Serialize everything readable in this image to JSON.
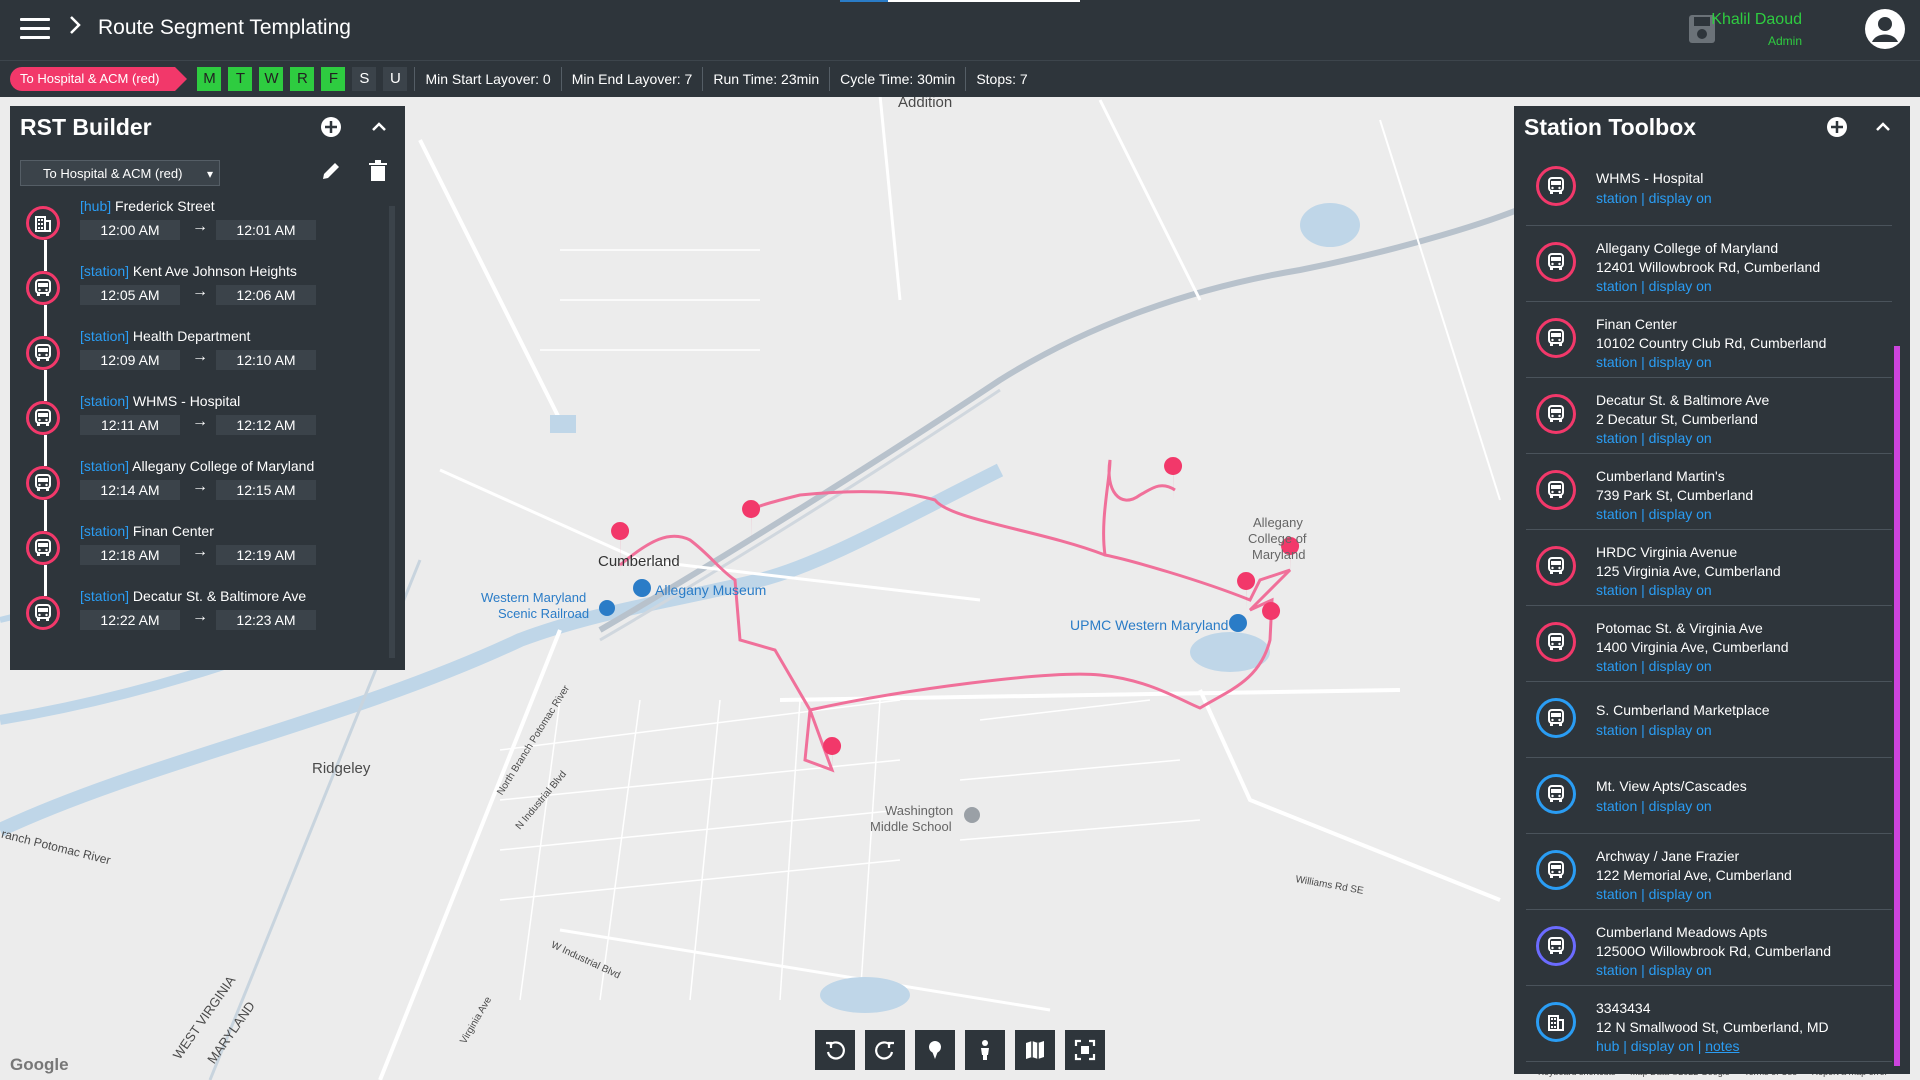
{
  "header": {
    "title": "Route Segment Templating",
    "user_name": "Khalil Daoud",
    "user_role": "Admin"
  },
  "infobar": {
    "route": "To Hospital & ACM (red)",
    "days": [
      {
        "label": "M",
        "active": true
      },
      {
        "label": "T",
        "active": true
      },
      {
        "label": "W",
        "active": true
      },
      {
        "label": "R",
        "active": true
      },
      {
        "label": "F",
        "active": true
      },
      {
        "label": "S",
        "active": false
      },
      {
        "label": "U",
        "active": false
      }
    ],
    "min_start_layover": "Min Start Layover:  0",
    "min_end_layover": "Min End Layover:  7",
    "run_time": "Run Time:  23min",
    "cycle_time": "Cycle Time:  30min",
    "stops": "Stops:  7"
  },
  "rst": {
    "title": "RST Builder",
    "selected_route": "To Hospital & ACM (red)",
    "stops": [
      {
        "type": "[hub]",
        "name": "Frederick Street",
        "arrive": "12:00 AM",
        "depart": "12:01 AM",
        "icon": "building-icon"
      },
      {
        "type": "[station]",
        "name": "Kent Ave Johnson Heights",
        "arrive": "12:05 AM",
        "depart": "12:06 AM",
        "icon": "bus-icon"
      },
      {
        "type": "[station]",
        "name": "Health Department",
        "arrive": "12:09 AM",
        "depart": "12:10 AM",
        "icon": "bus-icon"
      },
      {
        "type": "[station]",
        "name": "WHMS - Hospital",
        "arrive": "12:11 AM",
        "depart": "12:12 AM",
        "icon": "bus-icon"
      },
      {
        "type": "[station]",
        "name": "Allegany College of Maryland",
        "arrive": "12:14 AM",
        "depart": "12:15 AM",
        "icon": "bus-icon"
      },
      {
        "type": "[station]",
        "name": "Finan Center",
        "arrive": "12:18 AM",
        "depart": "12:19 AM",
        "icon": "bus-icon"
      },
      {
        "type": "[station]",
        "name": "Decatur St. & Baltimore Ave",
        "arrive": "12:22 AM",
        "depart": "12:23 AM",
        "icon": "bus-icon"
      }
    ]
  },
  "toolbox": {
    "title": "Station Toolbox",
    "items": [
      {
        "name": "WHMS - Hospital",
        "address": "",
        "links": "station | display on",
        "notes": "",
        "color": "#f2386a",
        "icon": "bus-icon"
      },
      {
        "name": "Allegany College of Maryland",
        "address": "12401 Willowbrook Rd, Cumberland",
        "links": "station | display on",
        "notes": "",
        "color": "#f2386a",
        "icon": "bus-icon"
      },
      {
        "name": "Finan Center",
        "address": "10102 Country Club Rd, Cumberland",
        "links": "station | display on",
        "notes": "",
        "color": "#f2386a",
        "icon": "bus-icon"
      },
      {
        "name": "Decatur St. & Baltimore Ave",
        "address": "2 Decatur St, Cumberland",
        "links": "station | display on",
        "notes": "",
        "color": "#f2386a",
        "icon": "bus-icon"
      },
      {
        "name": "Cumberland Martin's",
        "address": "739 Park St, Cumberland",
        "links": "station | display on",
        "notes": "",
        "color": "#f2386a",
        "icon": "bus-icon"
      },
      {
        "name": "HRDC Virginia Avenue",
        "address": "125 Virginia Ave, Cumberland",
        "links": "station | display on",
        "notes": "",
        "color": "#f2386a",
        "icon": "bus-icon"
      },
      {
        "name": "Potomac St. & Virginia Ave",
        "address": "1400 Virginia Ave, Cumberland",
        "links": "station | display on",
        "notes": "",
        "color": "#f2386a",
        "icon": "bus-icon"
      },
      {
        "name": "S. Cumberland Marketplace",
        "address": "",
        "links": "station | display on",
        "notes": "",
        "color": "#2a9df4",
        "icon": "bus-icon"
      },
      {
        "name": "Mt. View Apts/Cascades",
        "address": "",
        "links": "station | display on",
        "notes": "",
        "color": "#2a9df4",
        "icon": "bus-icon"
      },
      {
        "name": "Archway / Jane Frazier",
        "address": "122 Memorial Ave, Cumberland",
        "links": "station | display on",
        "notes": "",
        "color": "#2a9df4",
        "icon": "bus-icon"
      },
      {
        "name": "Cumberland Meadows Apts",
        "address": "12500O Willowbrook Rd, Cumberland",
        "links": "station | display on",
        "notes": "",
        "color": "#6b6bff",
        "icon": "bus-icon"
      },
      {
        "name": "3343434",
        "address": "12 N Smallwood St, Cumberland, MD",
        "links": "hub | display on | ",
        "notes": "notes",
        "color": "#2a9df4",
        "icon": "building-icon"
      }
    ]
  },
  "map": {
    "labels": {
      "addition": "Addition",
      "cumberland": "Cumberland",
      "western_md_1": "Western Maryland",
      "western_md_2": "Scenic Railroad",
      "allegany_museum": "Allegany Museum",
      "allegany_college_1": "Allegany",
      "allegany_college_2": "College of",
      "allegany_college_3": "Maryland",
      "upmc": "UPMC Western Maryland",
      "ridgeley": "Ridgeley",
      "washington_ms_1": "Washington",
      "washington_ms_2": "Middle School",
      "williams_rd": "Williams Rd SE",
      "north_branch": "North Branch Potomac River",
      "branch_potomac": "ranch Potomac River",
      "west_virginia": "WEST VIRGINIA",
      "maryland": "MARYLAND",
      "w_industrial": "W Industrial Blvd",
      "virginia_ave": "Virginia Ave",
      "n_industrial": "N Industrial Blvd"
    },
    "google": "Google",
    "footer": [
      "Keyboard shortcuts",
      "Map Data ©2022 Google",
      "Terms of Use",
      "Report a map error"
    ]
  },
  "map_tools": [
    "rotate-left-icon",
    "rotate-right-icon",
    "marker-icon",
    "person-icon",
    "map-icon",
    "fit-bounds-icon"
  ],
  "colors": {
    "accent": "#f2386a",
    "panel": "#2e353b",
    "link": "#2a9df4",
    "active_day": "#2ecc40"
  }
}
